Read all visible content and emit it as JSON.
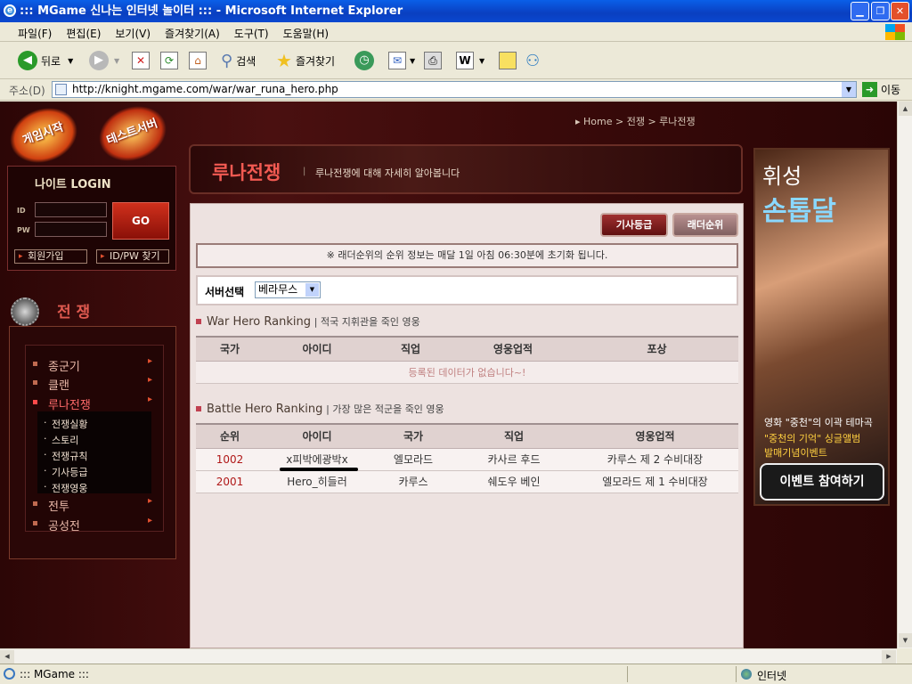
{
  "window": {
    "title": "::: MGame 신나는 인터넷 놀이터 ::: - Microsoft Internet Explorer"
  },
  "menu": {
    "items": [
      "파일(F)",
      "편집(E)",
      "보기(V)",
      "즐겨찾기(A)",
      "도구(T)",
      "도움말(H)"
    ]
  },
  "toolbar": {
    "back": "뒤로",
    "search": "검색",
    "favorites": "즐겨찾기"
  },
  "address": {
    "label": "주소(D)",
    "url": "http://knight.mgame.com/war/war_runa_hero.php",
    "go": "이동"
  },
  "left": {
    "game_start": "게임시작",
    "test_server": "테스트서버",
    "login": {
      "title": "나이트 LOGIN",
      "id_label": "ID",
      "pw_label": "PW",
      "go": "GO",
      "join": "회원가입",
      "find": "ID/PW 찾기"
    },
    "war_heading": "전 쟁",
    "menu": [
      "종군기",
      "클랜",
      "루나전쟁",
      "전투",
      "공성전"
    ],
    "submenu": [
      "전쟁실황",
      "스토리",
      "전쟁규칙",
      "기사등급",
      "전쟁영웅"
    ]
  },
  "header": {
    "breadcrumb": "▸ Home > 전쟁 > 루나전쟁",
    "title": "루나전쟁",
    "sep": "|",
    "desc": "루나전쟁에 대해 자세히 알아봅니다"
  },
  "content": {
    "btn_knight": "기사등급",
    "btn_ladder": "래더순위",
    "notice": "※ 래더순위의 순위 정보는 매달 1일 아침 06:30분에 초기화 됩니다.",
    "server_label": "서버선택",
    "server_value": "베라무스",
    "war_hero": {
      "title": "War Hero Ranking",
      "sub": "| 적국 지휘관을 죽인 영웅",
      "headers": [
        "국가",
        "아이디",
        "직업",
        "영웅업적",
        "포상"
      ],
      "empty": "등록된 데이터가 없습니다~!"
    },
    "battle_hero": {
      "title": "Battle Hero Ranking",
      "sub": "| 가장 많은 적군을 죽인 영웅",
      "headers": [
        "순위",
        "아이디",
        "국가",
        "직업",
        "영웅업적"
      ],
      "rows": [
        [
          "1002",
          "x피박에광박x",
          "엘모라드",
          "카사르 후드",
          "카루스 제 2 수비대장"
        ],
        [
          "2001",
          "Hero_히들러",
          "카루스",
          "쉐도우 베인",
          "엘모라드 제 1 수비대장"
        ]
      ]
    }
  },
  "ad": {
    "line1": "휘성",
    "line2": "손톱달",
    "line3": "영화 \"중천\"의 이곽 테마곡",
    "line4": "\"중천의 기억\" 싱글앨범",
    "line5": "발매기념이벤트",
    "button": "이벤트 참여하기"
  },
  "status": {
    "left": "::: MGame :::",
    "zone": "인터넷"
  }
}
